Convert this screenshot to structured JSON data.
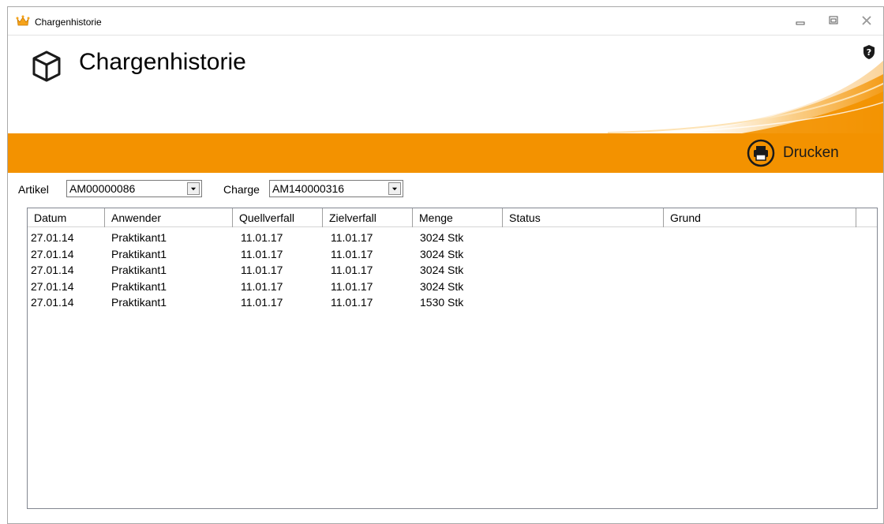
{
  "window": {
    "title": "Chargenhistorie"
  },
  "header": {
    "title": "Chargenhistorie",
    "accent_color": "#f39200"
  },
  "toolbar": {
    "print_label": "Drucken"
  },
  "filters": {
    "artikel_label": "Artikel",
    "artikel_value": "AM00000086",
    "charge_label": "Charge",
    "charge_value": "AM140000316"
  },
  "table": {
    "columns": [
      "Datum",
      "Anwender",
      "Quellverfall",
      "Zielverfall",
      "Menge",
      "Status",
      "Grund"
    ],
    "rows": [
      [
        "27.01.14",
        "Praktikant1",
        "11.01.17",
        "11.01.17",
        "3024 Stk",
        "",
        ""
      ],
      [
        "27.01.14",
        "Praktikant1",
        "11.01.17",
        "11.01.17",
        "3024 Stk",
        "",
        ""
      ],
      [
        "27.01.14",
        "Praktikant1",
        "11.01.17",
        "11.01.17",
        "3024 Stk",
        "",
        ""
      ],
      [
        "27.01.14",
        "Praktikant1",
        "11.01.17",
        "11.01.17",
        "3024 Stk",
        "",
        ""
      ],
      [
        "27.01.14",
        "Praktikant1",
        "11.01.17",
        "11.01.17",
        "1530 Stk",
        "",
        ""
      ]
    ]
  },
  "icons": {
    "app": "app-crown-icon",
    "header": "cube-icon",
    "help": "shield-help-icon",
    "print": "printer-icon"
  }
}
